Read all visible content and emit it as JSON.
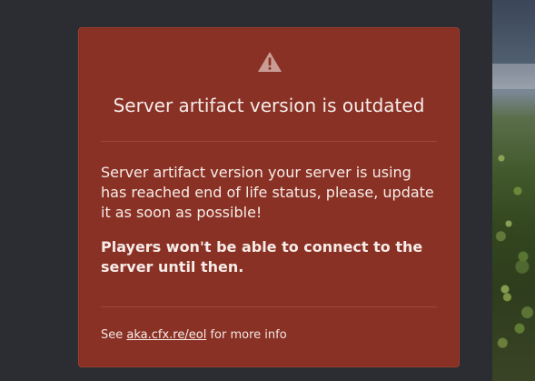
{
  "background": {
    "base_color": "#26282d",
    "panel_color": "#2b2d32",
    "scene_accent": "#4f6730"
  },
  "modal": {
    "background_color": "#8a3125",
    "border_color": "#a3402f",
    "title": "Server artifact version is outdated",
    "icon": "warning-icon",
    "body": "Server artifact version your server is using has reached end of life status, please, update it as soon as possible!",
    "strong_notice": "Players won't be able to connect to the server until then.",
    "footer": {
      "prefix": "See",
      "link_text": "aka.cfx.re/eol",
      "suffix": "for more info"
    }
  }
}
